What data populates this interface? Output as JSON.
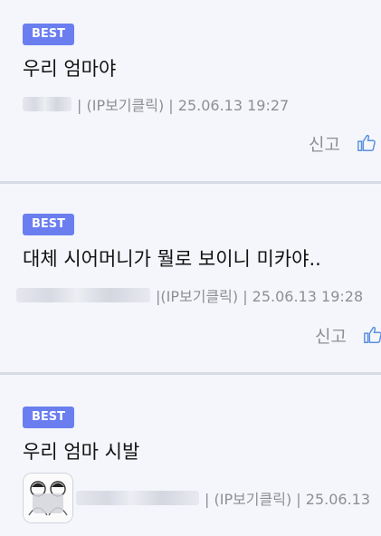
{
  "comments": [
    {
      "badge": "BEST",
      "text": "우리 엄마야",
      "meta": "| (IP보기클릭) | 25.06.13 19:27",
      "report": "신고"
    },
    {
      "badge": "BEST",
      "text": "대체 시어머니가 뭘로 보이니 미카야..",
      "meta": "|(IP보기클릭) | 25.06.13 19:28",
      "report": "신고"
    },
    {
      "badge": "BEST",
      "text": "우리 엄마 시발",
      "meta": "| (IP보기클릭) | 25.06.13"
    }
  ],
  "colors": {
    "badge": "#6a7ef0",
    "like": "#5b8fe0",
    "meta": "#8e8e95"
  },
  "icons": {
    "like": "thumbs-up-icon"
  }
}
